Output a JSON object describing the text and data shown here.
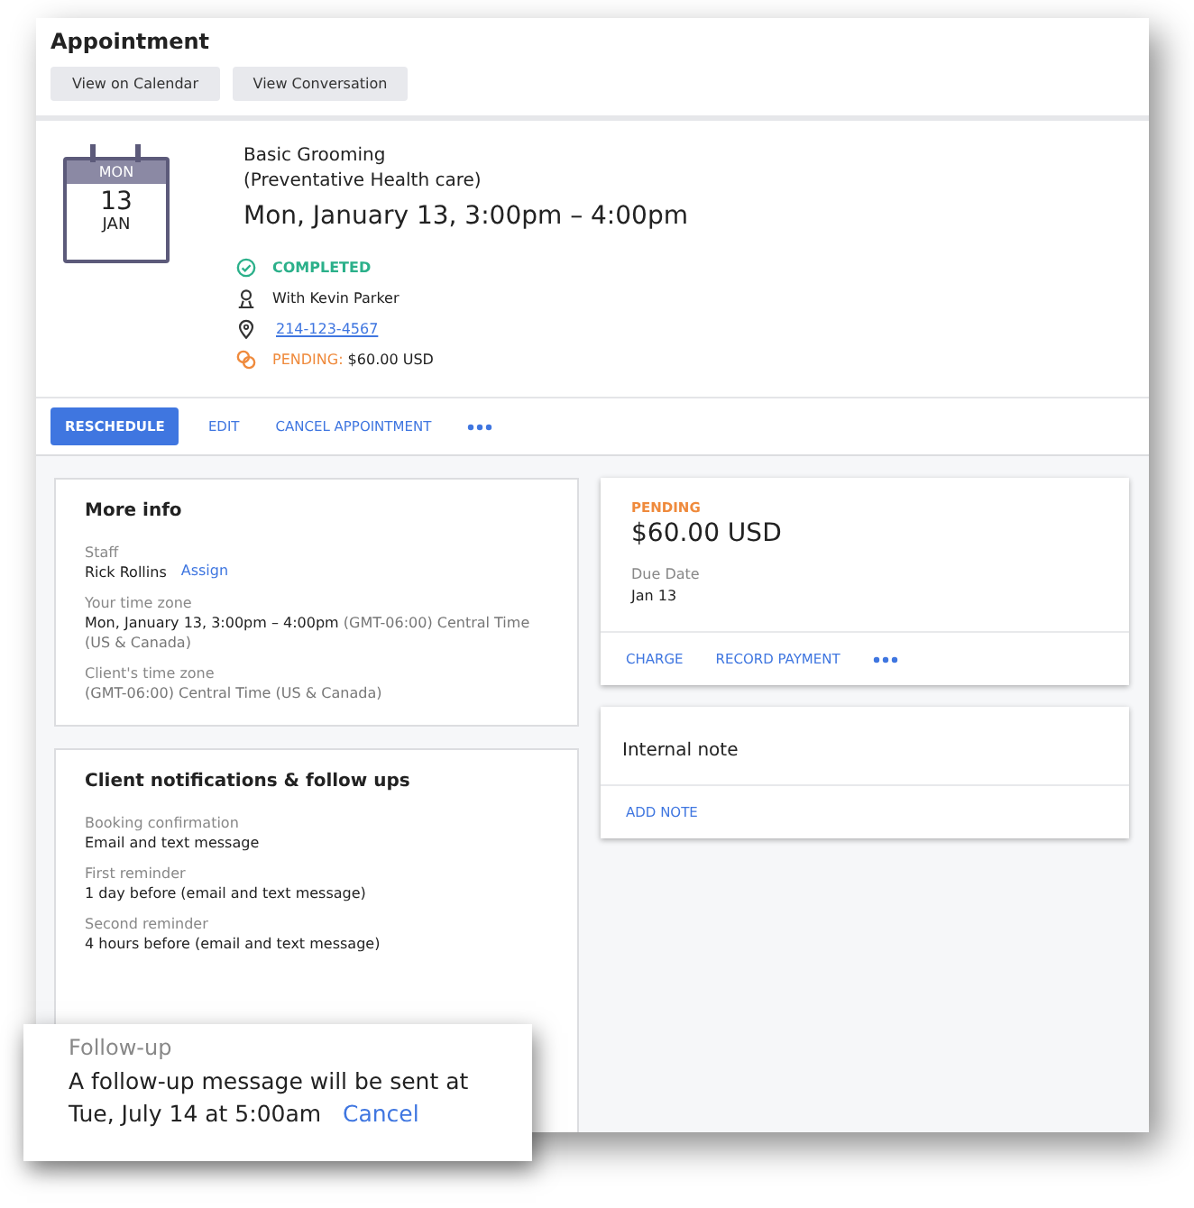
{
  "header": {
    "title": "Appointment",
    "buttons": [
      "View on Calendar",
      "View Conversation"
    ]
  },
  "calendar": {
    "weekday": "MON",
    "day": "13",
    "month": "JAN"
  },
  "service": {
    "name": "Basic Grooming",
    "category": "(Preventative Health care)",
    "when": "Mon, January 13, 3:00pm – 4:00pm"
  },
  "details": [
    {
      "kind": "status",
      "text": "COMPLETED"
    },
    {
      "kind": "person",
      "text": "With Kevin Parker"
    },
    {
      "kind": "phone",
      "text": "214-123-4567"
    },
    {
      "kind": "payment",
      "label": "PENDING:",
      "text": "$60.00 USD"
    }
  ],
  "actions": [
    {
      "label": "RESCHEDULE",
      "primary": true
    },
    {
      "label": "EDIT",
      "primary": false
    },
    {
      "label": "CANCEL APPOINTMENT",
      "primary": false
    }
  ],
  "more_info": {
    "title": "More info",
    "fields": [
      {
        "label": "Staff",
        "value": "Rick Rollins",
        "link": "Assign"
      },
      {
        "label": "Your time zone",
        "value": "Mon, January 13, 3:00pm – 4:00pm",
        "note": "(GMT-06:00) Central Time (US & Canada)"
      },
      {
        "label": "Client's time zone",
        "note": "(GMT-06:00) Central Time (US & Canada)"
      }
    ]
  },
  "notifications": {
    "title": "Client notifications & follow ups",
    "items": [
      {
        "label": "Booking confirmation",
        "value": "Email and text message"
      },
      {
        "label": "First reminder",
        "value": "1 day before (email and text message)"
      },
      {
        "label": "Second reminder",
        "value": "4 hours before (email and text message)"
      }
    ]
  },
  "payment": {
    "status": "PENDING",
    "amount": "$60.00 USD",
    "due_label": "Due Date",
    "due": "Jan 13",
    "actions": [
      "CHARGE",
      "RECORD PAYMENT"
    ]
  },
  "note": {
    "title": "Internal note",
    "action": "ADD NOTE"
  },
  "follow_up": {
    "label": "Follow-up",
    "text": "A follow-up message will be sent at Tue, July 14 at 5:00am",
    "link": "Cancel"
  }
}
